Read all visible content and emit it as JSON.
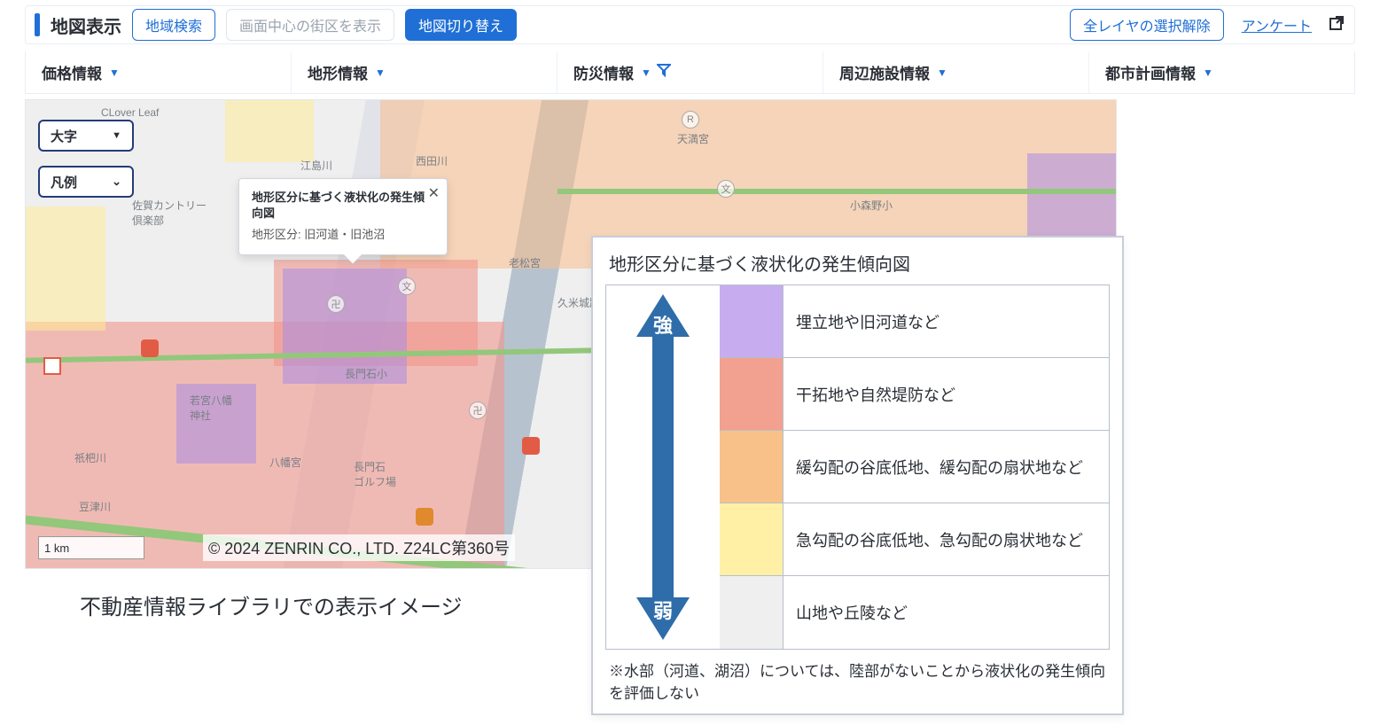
{
  "topbar": {
    "title": "地図表示",
    "search_btn": "地域検索",
    "center_block_btn": "画面中心の街区を表示",
    "switch_map_btn": "地図切り替え",
    "clear_layers_btn": "全レイヤの選択解除",
    "survey_link": "アンケート"
  },
  "layer_tabs": [
    {
      "label": "価格情報"
    },
    {
      "label": "地形情報"
    },
    {
      "label": "防災情報",
      "filtered": true
    },
    {
      "label": "周辺施設情報"
    },
    {
      "label": "都市計画情報"
    }
  ],
  "map_chips": {
    "oaza_label": "大字",
    "legend_label": "凡例"
  },
  "tooltip": {
    "title": "地形区分に基づく液状化の発生傾向図",
    "body": "地形区分: 旧河道・旧池沼"
  },
  "scalebar": {
    "label": "1 km"
  },
  "copyright": "© 2024 ZENRIN CO., LTD.  Z24LC第360号",
  "caption": "不動産情報ライブラリでの表示イメージ",
  "legend": {
    "title": "地形区分に基づく液状化の発生傾向図",
    "strong_label": "強",
    "weak_label": "弱",
    "rows": [
      {
        "color": "#c7adf0",
        "text": "埋立地や旧河道など"
      },
      {
        "color": "#f2a08f",
        "text": "干拓地や自然堤防など"
      },
      {
        "color": "#f7c189",
        "text": "緩勾配の谷底低地、緩勾配の扇状地など"
      },
      {
        "color": "#fff0a6",
        "text": "急勾配の谷底低地、急勾配の扇状地など"
      },
      {
        "color": "#efefef",
        "text": "山地や丘陵など"
      }
    ],
    "note": "※水部（河道、湖沼）については、陸部がないことから液状化の発生傾向を評価しない"
  }
}
